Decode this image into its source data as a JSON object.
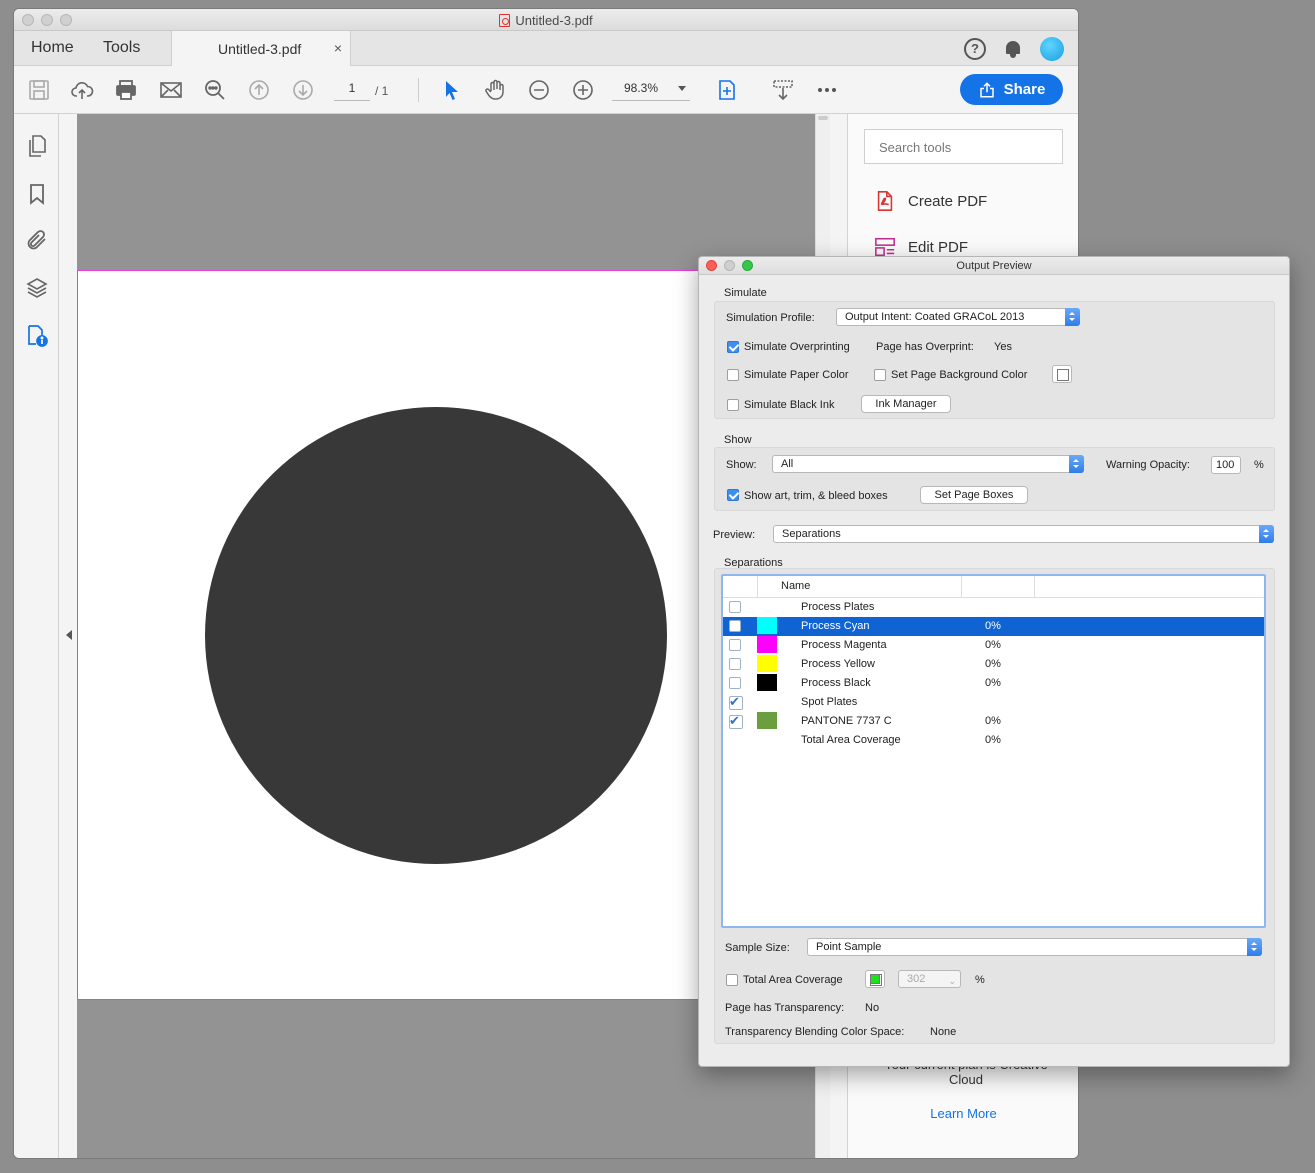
{
  "window": {
    "title": "Untitled-3.pdf"
  },
  "tabs": {
    "home": "Home",
    "tools": "Tools",
    "doc": "Untitled-3.pdf",
    "close": "×"
  },
  "toolbar": {
    "page_current": "1",
    "page_total": "/ 1",
    "zoom": "98.3%",
    "share_label": "Share"
  },
  "right_panel": {
    "search_placeholder": "Search tools",
    "tools": [
      "Create PDF",
      "Edit PDF"
    ],
    "plan_text": "Your current plan is Creative Cloud",
    "learn_more": "Learn More"
  },
  "colors": {
    "accent": "#1473e6",
    "trim_box": "#e83fe3",
    "circle_fill": "#383838"
  },
  "output_preview": {
    "title": "Output Preview",
    "simulate": {
      "section": "Simulate",
      "profile_label": "Simulation Profile:",
      "profile_value": "Output Intent: Coated GRACoL 2013",
      "simulate_overprinting": "Simulate Overprinting",
      "page_has_overprint_label": "Page has Overprint:",
      "page_has_overprint_value": "Yes",
      "simulate_paper_color": "Simulate Paper Color",
      "set_page_bg_color": "Set Page Background Color",
      "simulate_black_ink": "Simulate Black Ink",
      "ink_manager": "Ink Manager"
    },
    "show": {
      "section": "Show",
      "show_label": "Show:",
      "show_value": "All",
      "warning_opacity_label": "Warning Opacity:",
      "warning_opacity_value": "100",
      "percent": "%",
      "show_boxes": "Show art, trim, & bleed boxes",
      "set_page_boxes": "Set Page Boxes"
    },
    "preview": {
      "label": "Preview:",
      "value": "Separations"
    },
    "separations": {
      "section": "Separations",
      "col_name": "Name",
      "rows": [
        {
          "name": "Process Plates",
          "pct": "",
          "color": "",
          "checked": false,
          "selected": false
        },
        {
          "name": "Process Cyan",
          "pct": "0%",
          "color": "#00ffff",
          "checked": false,
          "selected": true
        },
        {
          "name": "Process Magenta",
          "pct": "0%",
          "color": "#ff00ff",
          "checked": false,
          "selected": false
        },
        {
          "name": "Process Yellow",
          "pct": "0%",
          "color": "#ffff00",
          "checked": false,
          "selected": false
        },
        {
          "name": "Process Black",
          "pct": "0%",
          "color": "#000000",
          "checked": false,
          "selected": false
        },
        {
          "name": "Spot Plates",
          "pct": "",
          "color": "",
          "checked": true,
          "selected": false
        },
        {
          "name": "PANTONE 7737 C",
          "pct": "0%",
          "color": "#6b9e3e",
          "checked": true,
          "selected": false
        },
        {
          "name": "Total Area Coverage",
          "pct": "0%",
          "color": "",
          "checked": null,
          "selected": false
        }
      ]
    },
    "sample_size": {
      "label": "Sample Size:",
      "value": "Point Sample"
    },
    "total_area_coverage": {
      "label": "Total Area Coverage",
      "value": "302",
      "percent": "%",
      "swatch": "#1ee01e"
    },
    "transparency": {
      "label": "Page has Transparency:",
      "value": "No"
    },
    "blending": {
      "label": "Transparency Blending Color Space:",
      "value": "None"
    }
  }
}
